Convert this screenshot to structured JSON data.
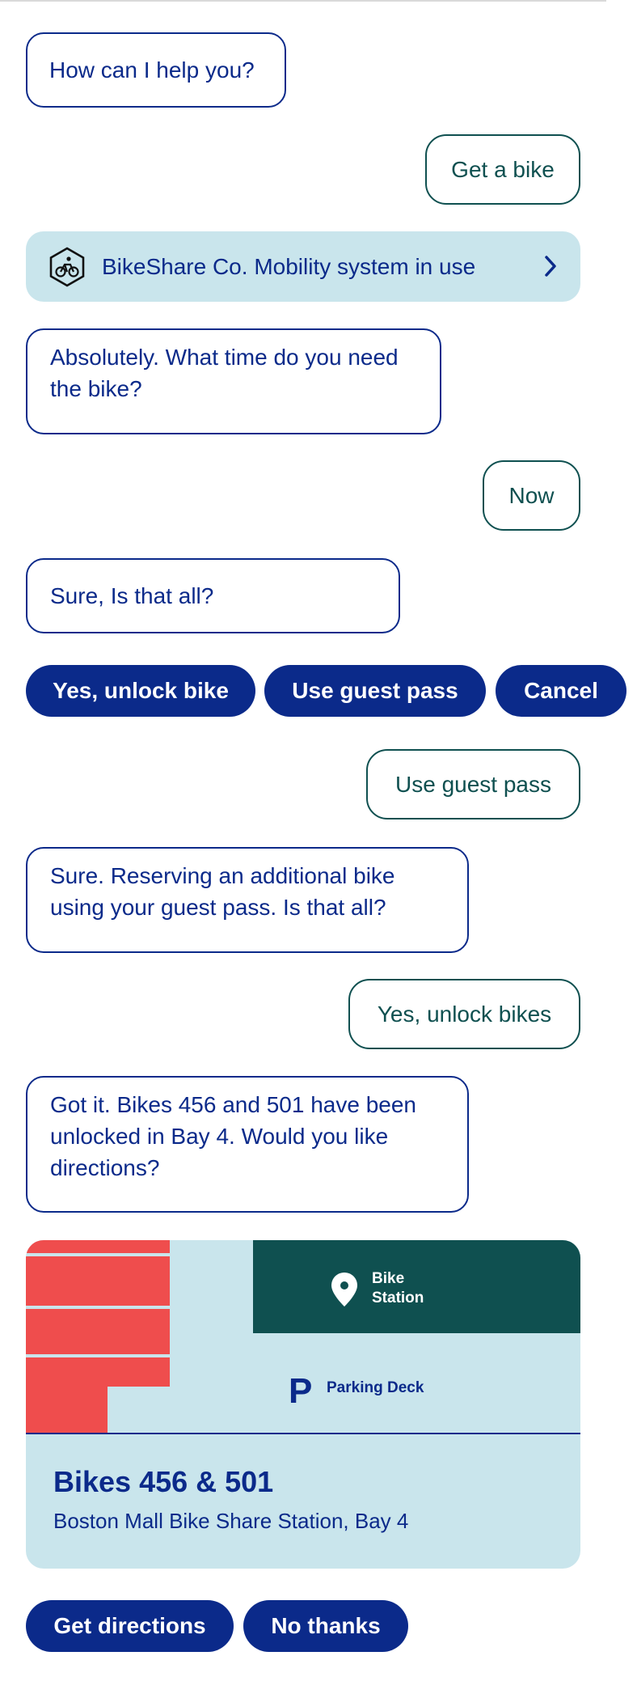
{
  "colors": {
    "bot_text": "#0b2a8a",
    "user_text": "#0f5050",
    "pill_bg": "#0b2a8a",
    "card_bg": "#c9e5ec",
    "station_bg": "#0f5050",
    "building": "#ef4d4d"
  },
  "messages": {
    "m1": "How can I help you?",
    "m2": "Get a bike",
    "system": "BikeShare Co. Mobility system in use",
    "m3": "Absolutely. What time do you need the bike?",
    "m4": "Now",
    "m5": "Sure, Is that all?",
    "m6": "Use guest pass",
    "m7": "Sure. Reserving an additional bike using your guest pass. Is that all?",
    "m8": "Yes, unlock bikes",
    "m9": "Got it. Bikes 456 and 501 have been unlocked in Bay 4. Would you like directions?"
  },
  "quick_replies_1": [
    "Yes, unlock bike",
    "Use guest pass",
    "Cancel"
  ],
  "map_card": {
    "station_line1": "Bike",
    "station_line2": "Station",
    "parking": "Parking Deck",
    "title": "Bikes 456 & 501",
    "subtitle": "Boston Mall Bike Share Station, Bay 4"
  },
  "quick_replies_2": [
    "Get directions",
    "No thanks"
  ],
  "icons": {
    "system": "bike-hexagon-icon",
    "chevron": "chevron-right-icon",
    "pin": "location-pin-icon",
    "parking": "parking-icon"
  }
}
